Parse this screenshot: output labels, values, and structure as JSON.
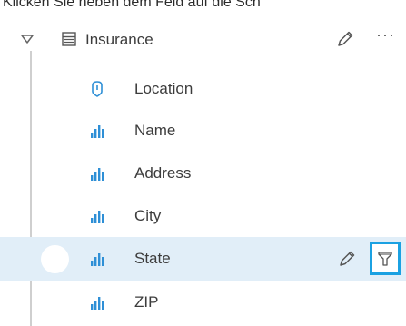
{
  "caption": "Klicken Sie neben dem Feld auf die Sch",
  "dataset": {
    "title": "Insurance",
    "more_label": "···"
  },
  "fields": [
    {
      "label": "Location",
      "type": "location",
      "selected": false
    },
    {
      "label": "Name",
      "type": "string",
      "selected": false
    },
    {
      "label": "Address",
      "type": "string",
      "selected": false
    },
    {
      "label": "City",
      "type": "string",
      "selected": false
    },
    {
      "label": "State",
      "type": "string",
      "selected": true
    },
    {
      "label": "ZIP",
      "type": "string",
      "selected": false
    }
  ],
  "colors": {
    "accent": "#1ba1e2",
    "selected_row": "#e1eef8",
    "icon": "#2e8fd6",
    "text": "#3c3c3c"
  },
  "icons": {
    "collapse": "triangle-down-icon",
    "dataset": "table-icon",
    "edit": "pencil-icon",
    "more": "ellipsis-icon",
    "location": "location-pin-icon",
    "string": "string-field-icon",
    "filter": "filter-icon"
  }
}
